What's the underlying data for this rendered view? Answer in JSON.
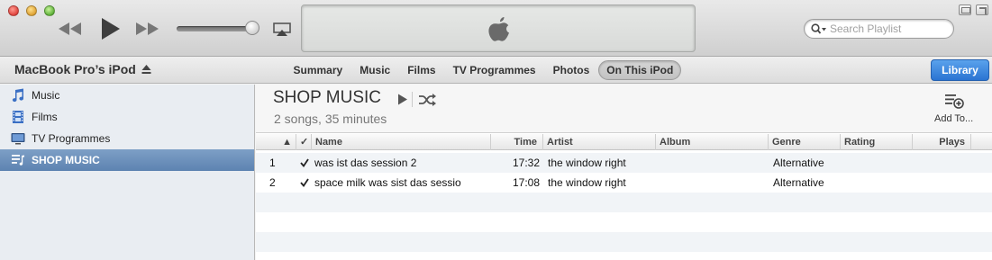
{
  "search": {
    "placeholder": "Search Playlist"
  },
  "device": {
    "name": "MacBook Pro’s iPod"
  },
  "tabs": [
    {
      "label": "Summary"
    },
    {
      "label": "Music"
    },
    {
      "label": "Films"
    },
    {
      "label": "TV Programmes"
    },
    {
      "label": "Photos"
    },
    {
      "label": "On This iPod",
      "active": true
    }
  ],
  "library_button": "Library",
  "sidebar": {
    "items": [
      {
        "label": "Music",
        "icon": "music-note-icon"
      },
      {
        "label": "Films",
        "icon": "film-icon"
      },
      {
        "label": "TV Programmes",
        "icon": "tv-icon"
      },
      {
        "label": "SHOP MUSIC",
        "icon": "playlist-icon",
        "selected": true
      }
    ]
  },
  "playlist": {
    "title": "SHOP MUSIC",
    "subtitle": "2 songs, 35 minutes",
    "add_to_label": "Add To..."
  },
  "table": {
    "columns": [
      "",
      "✓",
      "Name",
      "Time",
      "Artist",
      "Album",
      "Genre",
      "Rating",
      "Plays"
    ],
    "rows": [
      {
        "num": "1",
        "checked": true,
        "name": "was ist das session 2",
        "time": "17:32",
        "artist": "the window right",
        "album": "",
        "genre": "Alternative",
        "rating": "",
        "plays": ""
      },
      {
        "num": "2",
        "checked": true,
        "name": "space milk was sist das sessio",
        "time": "17:08",
        "artist": "the window right",
        "album": "",
        "genre": "Alternative",
        "rating": "",
        "plays": ""
      }
    ]
  },
  "colors": {
    "accent": "#2a74d2",
    "selection": "#6a8fbb"
  }
}
